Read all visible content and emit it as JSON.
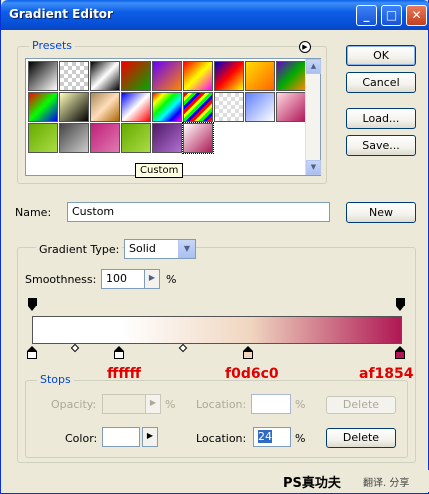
{
  "window": {
    "title": "Gradient Editor"
  },
  "presets": {
    "label": "Presets",
    "tooltip": "Custom"
  },
  "buttons": {
    "ok": "OK",
    "cancel": "Cancel",
    "load": "Load...",
    "save": "Save...",
    "new": "New",
    "delete_opacity": "Delete",
    "delete_color": "Delete"
  },
  "name": {
    "label": "Name:",
    "value": "Custom"
  },
  "gradient_type": {
    "label": "Gradient Type:",
    "value": "Solid"
  },
  "smoothness": {
    "label": "Smoothness:",
    "value": "100",
    "unit": "%"
  },
  "stops": {
    "label": "Stops",
    "opacity_label": "Opacity:",
    "opacity_unit": "%",
    "opacity_location_label": "Location:",
    "opacity_location_unit": "%",
    "color_label": "Color:",
    "color_location_label": "Location:",
    "color_location_value": "24",
    "color_location_unit": "%"
  },
  "color_stops": [
    {
      "hex": "ffffff",
      "color": "#ffffff"
    },
    {
      "hex": "f0d6c0",
      "color": "#f0d6c0"
    },
    {
      "hex": "af1854",
      "color": "#af1854"
    }
  ],
  "watermark": {
    "brand": "PS真功夫",
    "tag": "翻译. 分享"
  },
  "colors": {
    "accent": "#0046d5",
    "hex_label": "#e00000",
    "grad_start": "#ffffff",
    "grad_mid": "#f0d6c0",
    "grad_end": "#af1854"
  }
}
